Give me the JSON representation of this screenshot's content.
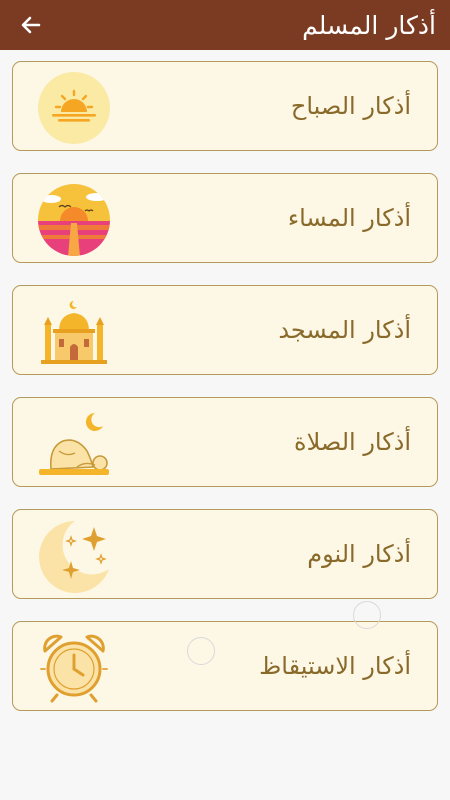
{
  "appbar": {
    "title": "أذكار المسلم",
    "back_icon": "arrow-left-icon",
    "background": "#7b3a22"
  },
  "colors": {
    "card_bg": "#fdf8e6",
    "card_border": "#b59a5a",
    "label": "#8a6a2a",
    "accent": "#f5b52a"
  },
  "items": [
    {
      "label": "أذكار الصباح",
      "icon": "sunrise-icon"
    },
    {
      "label": "أذكار المساء",
      "icon": "sunset-icon"
    },
    {
      "label": "أذكار المسجد",
      "icon": "mosque-icon"
    },
    {
      "label": "أذكار الصلاة",
      "icon": "prostration-icon"
    },
    {
      "label": "أذكار النوم",
      "icon": "moon-stars-icon"
    },
    {
      "label": "أذكار الاستيقاظ",
      "icon": "alarm-clock-icon"
    }
  ]
}
